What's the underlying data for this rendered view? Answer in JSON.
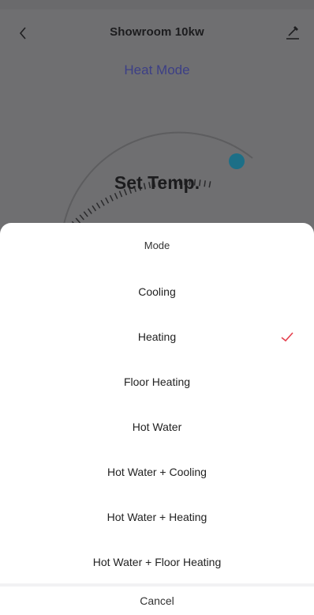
{
  "colors": {
    "overlay_bg": "#6f6f71",
    "sheet_bg": "#ffffff",
    "mode_label": "#3c3f86",
    "dial_knob": "#1d6f87",
    "check": "#e5404e"
  },
  "background": {
    "title": "Showroom 10kw",
    "mode": "Heat Mode",
    "set_temp": "Set Temp.",
    "back_icon": "chevron-left-icon",
    "edit_icon": "edit-pencil-icon"
  },
  "sheet": {
    "title": "Mode",
    "options": [
      {
        "label": "Cooling",
        "selected": false
      },
      {
        "label": "Heating",
        "selected": true
      },
      {
        "label": "Floor Heating",
        "selected": false
      },
      {
        "label": "Hot Water",
        "selected": false
      },
      {
        "label": "Hot Water + Cooling",
        "selected": false
      },
      {
        "label": "Hot Water + Heating",
        "selected": false
      },
      {
        "label": "Hot Water + Floor Heating",
        "selected": false
      }
    ],
    "cancel": "Cancel",
    "check_icon": "checkmark-icon"
  }
}
